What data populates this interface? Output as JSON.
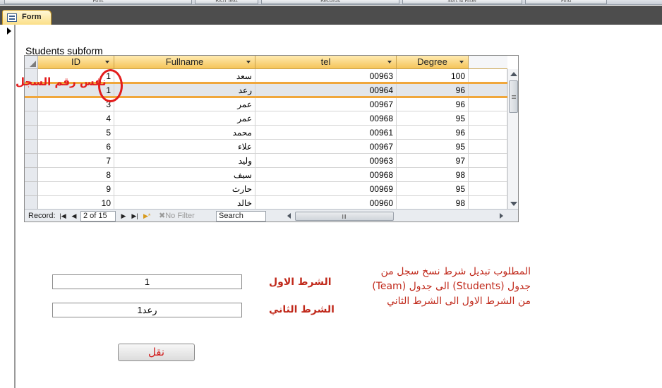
{
  "ribbon": {
    "groups": [
      "Font",
      "Rich Text",
      "Records",
      "Sort & Filter",
      "Find"
    ]
  },
  "tab": {
    "label": "Form"
  },
  "subform": {
    "label": "Students subform",
    "columns": [
      "ID",
      "Fullname",
      "tel",
      "Degree"
    ],
    "rows": [
      {
        "id": "1",
        "fullname": "سعد",
        "tel": "00963",
        "degree": "100"
      },
      {
        "id": "1",
        "fullname": "رعد",
        "tel": "00964",
        "degree": "96"
      },
      {
        "id": "3",
        "fullname": "عمر",
        "tel": "00967",
        "degree": "96"
      },
      {
        "id": "4",
        "fullname": "عمر",
        "tel": "00968",
        "degree": "95"
      },
      {
        "id": "5",
        "fullname": "محمد",
        "tel": "00961",
        "degree": "96"
      },
      {
        "id": "6",
        "fullname": "علاء",
        "tel": "00967",
        "degree": "95"
      },
      {
        "id": "7",
        "fullname": "وليد",
        "tel": "00963",
        "degree": "97"
      },
      {
        "id": "8",
        "fullname": "سيف",
        "tel": "00968",
        "degree": "98"
      },
      {
        "id": "9",
        "fullname": "حارث",
        "tel": "00969",
        "degree": "95"
      },
      {
        "id": "10",
        "fullname": "خالد",
        "tel": "00960",
        "degree": "98"
      }
    ],
    "navigation": {
      "label": "Record:",
      "position": "2 of 15",
      "filter": "No Filter",
      "search": "Search"
    }
  },
  "annotation": {
    "text": "نفس رقم السجل"
  },
  "conditions": {
    "first_label": "الشرط الاول",
    "first_value": "1",
    "second_label": "الشرط الثاني",
    "second_value": "1رعد"
  },
  "note": {
    "line1": "المطلوب تبديل شرط نسخ سجل من",
    "line2": "جدول (Students) الى جدول (Team)",
    "line3": "من الشرط الاول الى الشرط الثاني"
  },
  "move_button": {
    "label": "نقل"
  },
  "colors": {
    "accent_red": "#e31c1c",
    "header_orange": "#f5c55a",
    "tabbar": "#4d4d4d"
  }
}
